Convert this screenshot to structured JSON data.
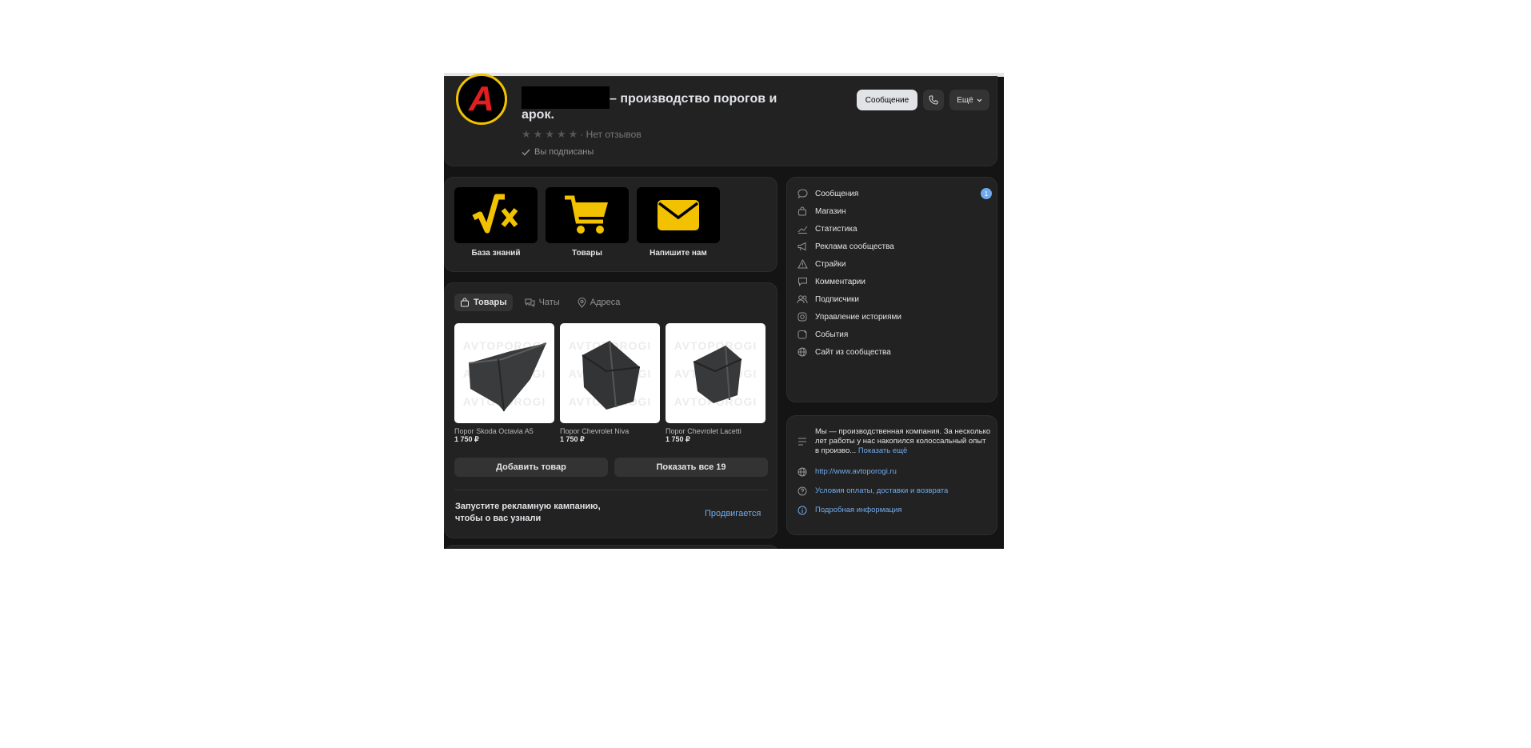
{
  "header": {
    "title_line1": "– производство порогов и",
    "title_line2": "арок.",
    "avatar_letter": "A",
    "rating_text": "· Нет отзывов",
    "subscribed_text": "Вы подписаны",
    "message_button": "Сообщение",
    "more_button": "Ещё"
  },
  "menu": [
    {
      "label": "База знаний",
      "icon": "math-sqrt-icon"
    },
    {
      "label": "Товары",
      "icon": "cart-icon"
    },
    {
      "label": "Напишите нам",
      "icon": "envelope-icon"
    }
  ],
  "tabs": [
    {
      "label": "Товары",
      "icon": "bag-icon",
      "active": true
    },
    {
      "label": "Чаты",
      "icon": "chat-icon",
      "active": false
    },
    {
      "label": "Адреса",
      "icon": "pin-icon",
      "active": false
    }
  ],
  "products": [
    {
      "name": "Порог Skoda Octavia A5",
      "price": "1 750 ₽"
    },
    {
      "name": "Порог Chevrolet Niva",
      "price": "1 750 ₽"
    },
    {
      "name": "Порог Chevrolet Lacetti",
      "price": "1 750 ₽"
    }
  ],
  "watermark": "AVTOPOROGI",
  "goods_buttons": {
    "add": "Добавить товар",
    "show_all": "Показать все 19"
  },
  "promo": {
    "text": "Запустите рекламную кампанию, чтобы о вас узнали",
    "link": "Продвигается"
  },
  "sidebar": [
    {
      "label": "Сообщения",
      "icon": "message-icon",
      "badge": "1"
    },
    {
      "label": "Магазин",
      "icon": "shop-bag-icon"
    },
    {
      "label": "Статистика",
      "icon": "stats-icon"
    },
    {
      "label": "Реклама сообщества",
      "icon": "megaphone-icon"
    },
    {
      "label": "Страйки",
      "icon": "warning-icon"
    },
    {
      "label": "Комментарии",
      "icon": "comment-icon"
    },
    {
      "label": "Подписчики",
      "icon": "users-icon"
    },
    {
      "label": "Управление историями",
      "icon": "stories-icon"
    },
    {
      "label": "События",
      "icon": "events-icon"
    },
    {
      "label": "Сайт из сообщества",
      "icon": "globe-icon"
    }
  ],
  "info": {
    "description": "Мы — производственная компания. За несколько лет работы у нас накопился колоссальный опыт в произво...",
    "show_more": "Показать ещё",
    "website": "http://www.avtoporogi.ru",
    "terms": "Условия оплаты, доставки и возврата",
    "details": "Подробная информация"
  },
  "colors": {
    "accent": "#71aaeb",
    "brand_yellow": "#f2c200",
    "brand_red": "#e41e1e",
    "card": "#222222"
  }
}
